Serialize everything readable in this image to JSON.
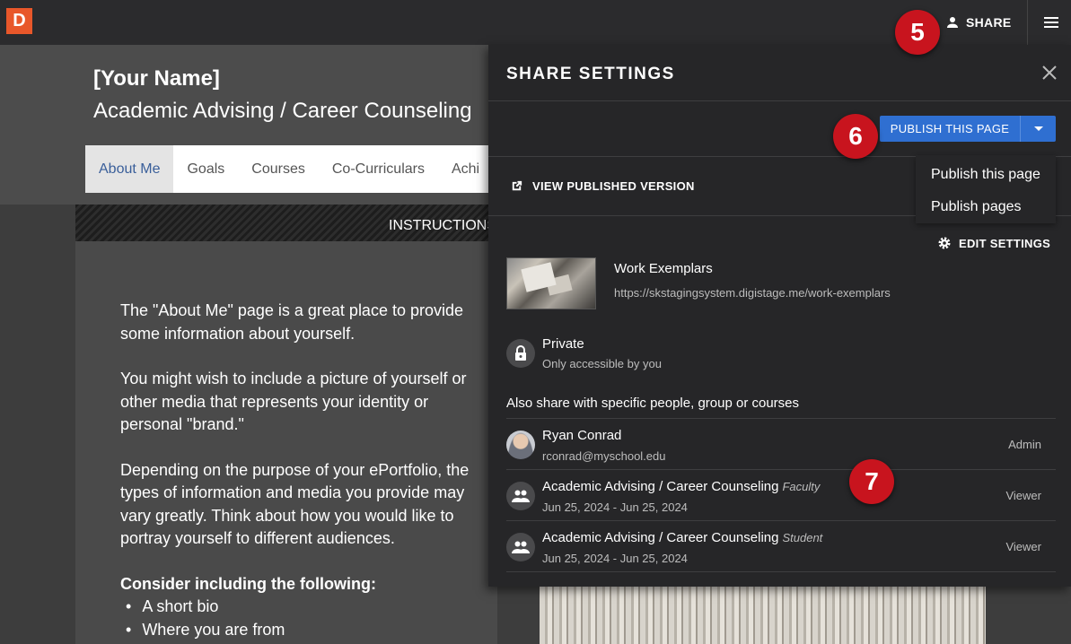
{
  "topbar": {
    "logo_letter": "D",
    "share_label": "SHARE",
    "share_icon": "person-icon",
    "menu_icon": "hamburger-menu-icon"
  },
  "page": {
    "name": "[Your Name]",
    "subtitle": "Academic Advising / Career Counseling",
    "nav": [
      "About Me",
      "Goals",
      "Courses",
      "Co-Curriculars",
      "Achi"
    ],
    "active_nav": "About Me",
    "instructions": "INSTRUCTIONS",
    "paragraphs": [
      [
        "The \"About Me\" page is a great place to provide",
        "some information about yourself."
      ],
      [
        "You might wish to include a picture of yourself or",
        "other media that represents your identity or",
        "personal \"brand.\""
      ],
      [
        "Depending on the purpose of your ePortfolio, the",
        "types of information and media you provide may",
        "vary greatly. Think about how you would like to",
        "portray yourself to different audiences."
      ]
    ],
    "consider_heading": "Consider including the following:",
    "bullets": [
      "A short bio",
      "Where you are from"
    ]
  },
  "share_panel": {
    "title": "SHARE SETTINGS",
    "close_icon": "close-icon",
    "publish_button": "PUBLISH THIS PAGE",
    "publish_menu": [
      "Publish this page",
      "Publish pages"
    ],
    "view_published": "VIEW PUBLISHED VERSION",
    "edit_settings": "EDIT SETTINGS",
    "page_item": {
      "title": "Work Exemplars",
      "url": "https://skstagingsystem.digistage.me/work-exemplars"
    },
    "privacy": {
      "label": "Private",
      "description": "Only accessible by you",
      "icon": "lock-icon"
    },
    "also_share_label": "Also share with specific people, group or courses",
    "share_list": [
      {
        "name": "Ryan Conrad",
        "role_tag": "",
        "sub": "rconrad@myschool.edu",
        "permission": "Admin",
        "avatar": "user-photo"
      },
      {
        "name": "Academic Advising / Career Counseling",
        "role_tag": "Faculty",
        "sub": "Jun 25, 2024 - Jun 25, 2024",
        "permission": "Viewer",
        "avatar": "group-icon"
      },
      {
        "name": "Academic Advising / Career Counseling",
        "role_tag": "Student",
        "sub": "Jun 25, 2024 - Jun 25, 2024",
        "permission": "Viewer",
        "avatar": "group-icon"
      }
    ]
  },
  "callouts": [
    "5",
    "6",
    "7"
  ],
  "colors": {
    "accent": "#2f6fd1",
    "logo": "#e8572a",
    "callout": "#c8141e",
    "panel_bg": "#262628"
  }
}
